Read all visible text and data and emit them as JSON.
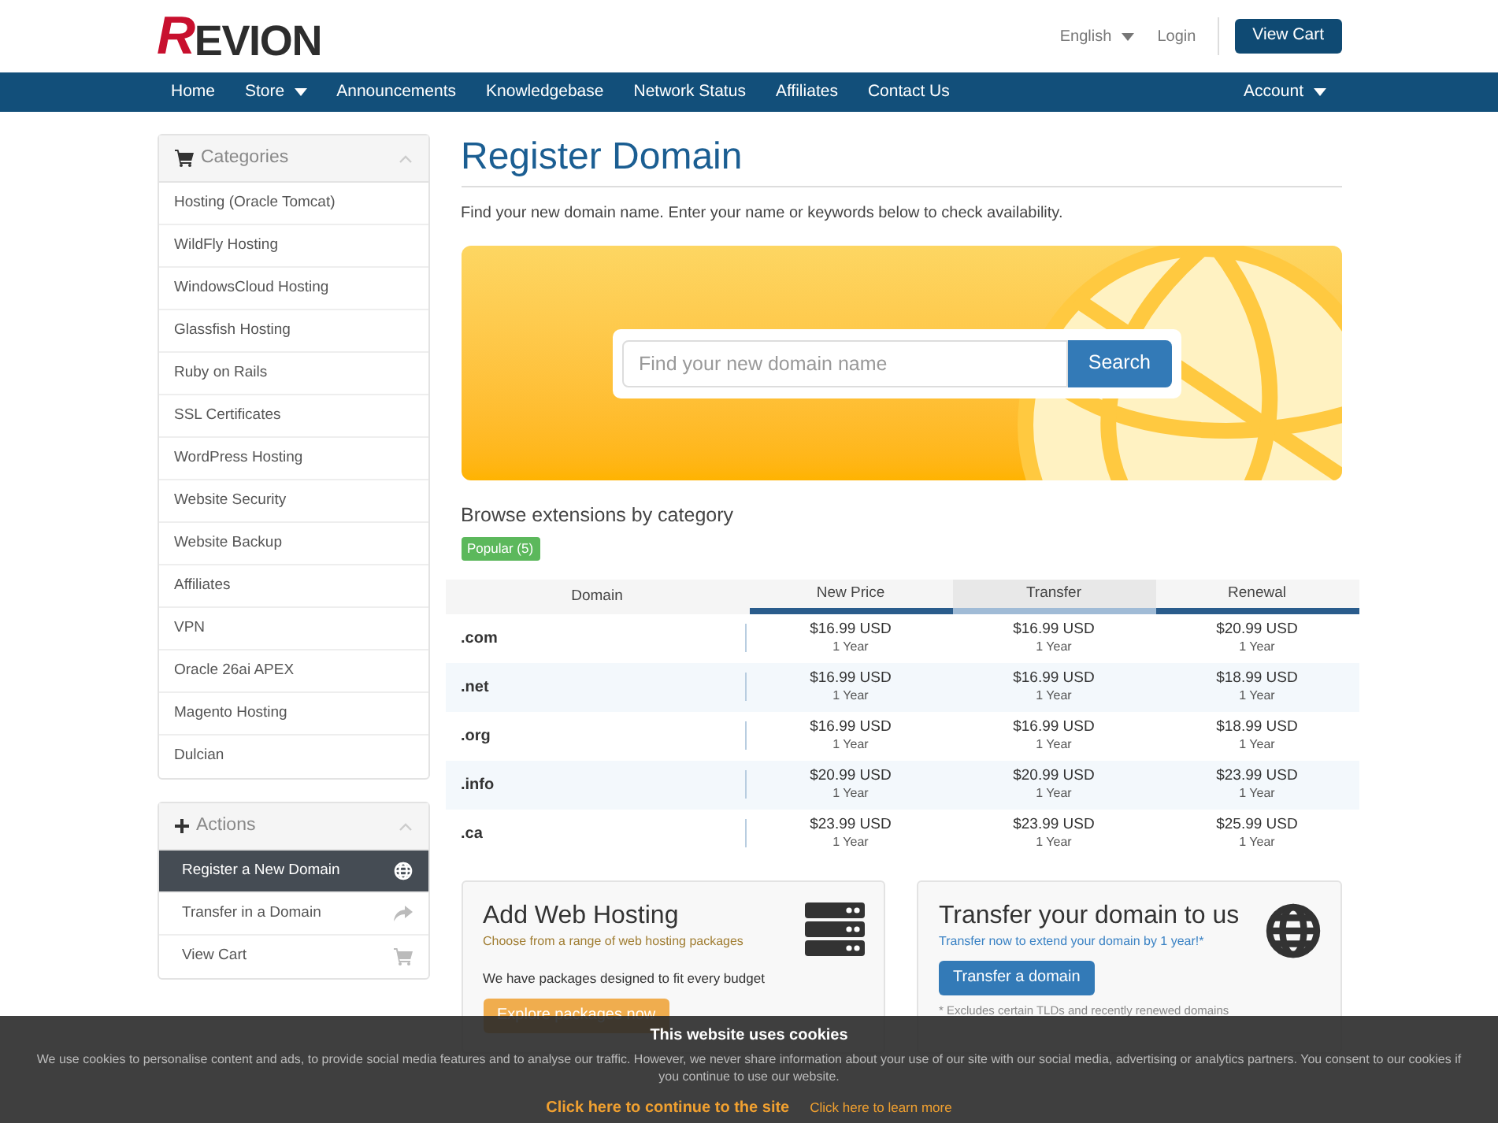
{
  "header": {
    "logo": {
      "accent": "R",
      "rest": "EVION"
    },
    "language": "English",
    "login": "Login",
    "view_cart": "View Cart"
  },
  "nav": {
    "items": [
      {
        "label": "Home",
        "dropdown": false
      },
      {
        "label": "Store",
        "dropdown": true
      },
      {
        "label": "Announcements",
        "dropdown": false
      },
      {
        "label": "Knowledgebase",
        "dropdown": false
      },
      {
        "label": "Network Status",
        "dropdown": false
      },
      {
        "label": "Affiliates",
        "dropdown": false
      },
      {
        "label": "Contact Us",
        "dropdown": false
      }
    ],
    "account": "Account"
  },
  "sidebar": {
    "panels": [
      {
        "title": "Categories",
        "kind": "categories",
        "items": [
          {
            "label": "Hosting (Oracle Tomcat)",
            "selected": false
          },
          {
            "label": "WildFly Hosting",
            "selected": false
          },
          {
            "label": "WindowsCloud Hosting",
            "selected": false
          },
          {
            "label": "Glassfish Hosting",
            "selected": false
          },
          {
            "label": "Ruby on Rails",
            "selected": false
          },
          {
            "label": "SSL Certificates",
            "selected": false
          },
          {
            "label": "WordPress Hosting",
            "selected": false
          },
          {
            "label": "Website Security",
            "selected": false
          },
          {
            "label": "Website Backup",
            "selected": false
          },
          {
            "label": "Affiliates",
            "selected": false
          },
          {
            "label": "VPN",
            "selected": false
          },
          {
            "label": "Oracle 26ai APEX",
            "selected": false
          },
          {
            "label": "Magento Hosting",
            "selected": false
          },
          {
            "label": "Dulcian",
            "selected": false
          }
        ]
      },
      {
        "title": "Actions",
        "kind": "actions",
        "items": [
          {
            "label": "Register a New Domain",
            "selected": true,
            "kind": "register"
          },
          {
            "label": "Transfer in a Domain",
            "selected": false,
            "kind": "transfer"
          },
          {
            "label": "View Cart",
            "selected": false,
            "kind": "cart"
          }
        ]
      }
    ]
  },
  "main": {
    "title": "Register Domain",
    "intro": "Find your new domain name. Enter your name or keywords below to check availability.",
    "search": {
      "placeholder": "Find your new domain name",
      "button": "Search"
    },
    "browse_title": "Browse extensions by category",
    "categories": [
      {
        "label": "Popular (5)",
        "selected": true
      }
    ],
    "table": {
      "columns": [
        {
          "label": "Domain",
          "selected": false
        },
        {
          "label": "New Price",
          "selected": false
        },
        {
          "label": "Transfer",
          "selected": true
        },
        {
          "label": "Renewal",
          "selected": false
        }
      ],
      "rows": [
        {
          "tld": ".com",
          "new": "$16.99 USD",
          "new_term": "1 Year",
          "transfer": "$16.99 USD",
          "transfer_term": "1 Year",
          "renewal": "$20.99 USD",
          "renewal_term": "1 Year"
        },
        {
          "tld": ".net",
          "new": "$16.99 USD",
          "new_term": "1 Year",
          "transfer": "$16.99 USD",
          "transfer_term": "1 Year",
          "renewal": "$18.99 USD",
          "renewal_term": "1 Year"
        },
        {
          "tld": ".org",
          "new": "$16.99 USD",
          "new_term": "1 Year",
          "transfer": "$16.99 USD",
          "transfer_term": "1 Year",
          "renewal": "$18.99 USD",
          "renewal_term": "1 Year"
        },
        {
          "tld": ".info",
          "new": "$20.99 USD",
          "new_term": "1 Year",
          "transfer": "$20.99 USD",
          "transfer_term": "1 Year",
          "renewal": "$23.99 USD",
          "renewal_term": "1 Year"
        },
        {
          "tld": ".ca",
          "new": "$23.99 USD",
          "new_term": "1 Year",
          "transfer": "$23.99 USD",
          "transfer_term": "1 Year",
          "renewal": "$25.99 USD",
          "renewal_term": "1 Year"
        }
      ]
    },
    "promos": [
      {
        "kind": "hosting",
        "title": "Add Web Hosting",
        "subtitle": "Choose from a range of web hosting packages",
        "body": "We have packages designed to fit every budget",
        "button": "Explore packages now"
      },
      {
        "kind": "transfer",
        "title": "Transfer your domain to us",
        "subtitle": "Transfer now to extend your domain by 1 year!*",
        "button": "Transfer a domain",
        "note": "* Excludes certain TLDs and recently renewed domains"
      }
    ]
  },
  "cookie_banner": {
    "title": "This website uses cookies",
    "text": "We use cookies to personalise content and ads, to provide social media features and to analyse our traffic. However, we never share information about your use of our site with our social media, advertising or analytics partners. You consent to our cookies if you continue to use our website.",
    "accept": "Click here to continue to the site",
    "learn_more": "Click here to learn more"
  }
}
